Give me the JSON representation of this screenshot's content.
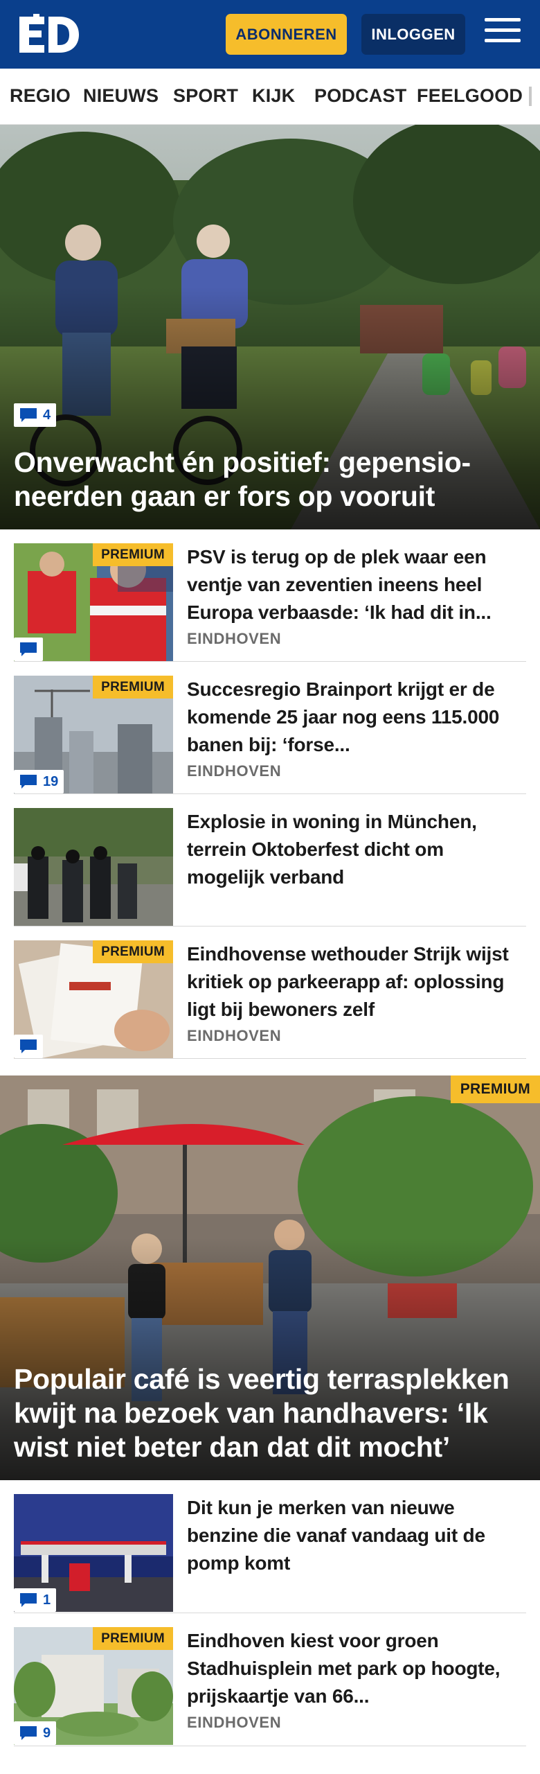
{
  "header": {
    "logo_text": "ED",
    "subscribe_label": "ABONNEREN",
    "login_label": "INLOGGEN",
    "menu_icon": "hamburger-menu-icon",
    "brand_color": "#0a3f8c",
    "accent_color": "#f6bd2b"
  },
  "nav": {
    "items": [
      "REGIO",
      "NIEUWS",
      "SPORT",
      "KIJK",
      "PODCAST",
      "FEELGOOD"
    ]
  },
  "hero1": {
    "comments": "4",
    "title": "Onverwacht én positief: gepensio-neerden gaan er fors op vooruit"
  },
  "articles": [
    {
      "premium": "PREMIUM",
      "comments": "",
      "title": "PSV is terug op de plek waar een ventje van zeventien ineens heel Europa verbaasde: ‘Ik had dit in...",
      "label": "EINDHOVEN"
    },
    {
      "premium": "PREMIUM",
      "comments": "19",
      "title": "Succesregio Brainport krijgt er de komende 25 jaar nog eens 115.000 banen bij: ‘forse...",
      "label": "EINDHOVEN"
    },
    {
      "premium": "",
      "comments": "",
      "title": "Explosie in woning in München, terrein Oktoberfest dicht om mogelijk verband",
      "label": ""
    },
    {
      "premium": "PREMIUM",
      "comments": "",
      "title": "Eindhovense wethouder Strijk wijst kritiek op parkeerapp af: oplossing ligt bij bewoners zelf",
      "label": "EINDHOVEN"
    }
  ],
  "hero2": {
    "premium": "PREMIUM",
    "title": "Populair café is veertig terrasplekken kwijt na bezoek van handhavers: ‘Ik wist niet beter dan dat dit mocht’"
  },
  "articles2": [
    {
      "premium": "",
      "comments": "1",
      "title": "Dit kun je merken van nieuwe benzine die vanaf vandaag uit de pomp komt",
      "label": ""
    },
    {
      "premium": "PREMIUM",
      "comments": "9",
      "title": "Eindhoven kiest voor groen Stadhuisplein met park op hoogte, prijskaartje van 66...",
      "label": "EINDHOVEN"
    }
  ]
}
